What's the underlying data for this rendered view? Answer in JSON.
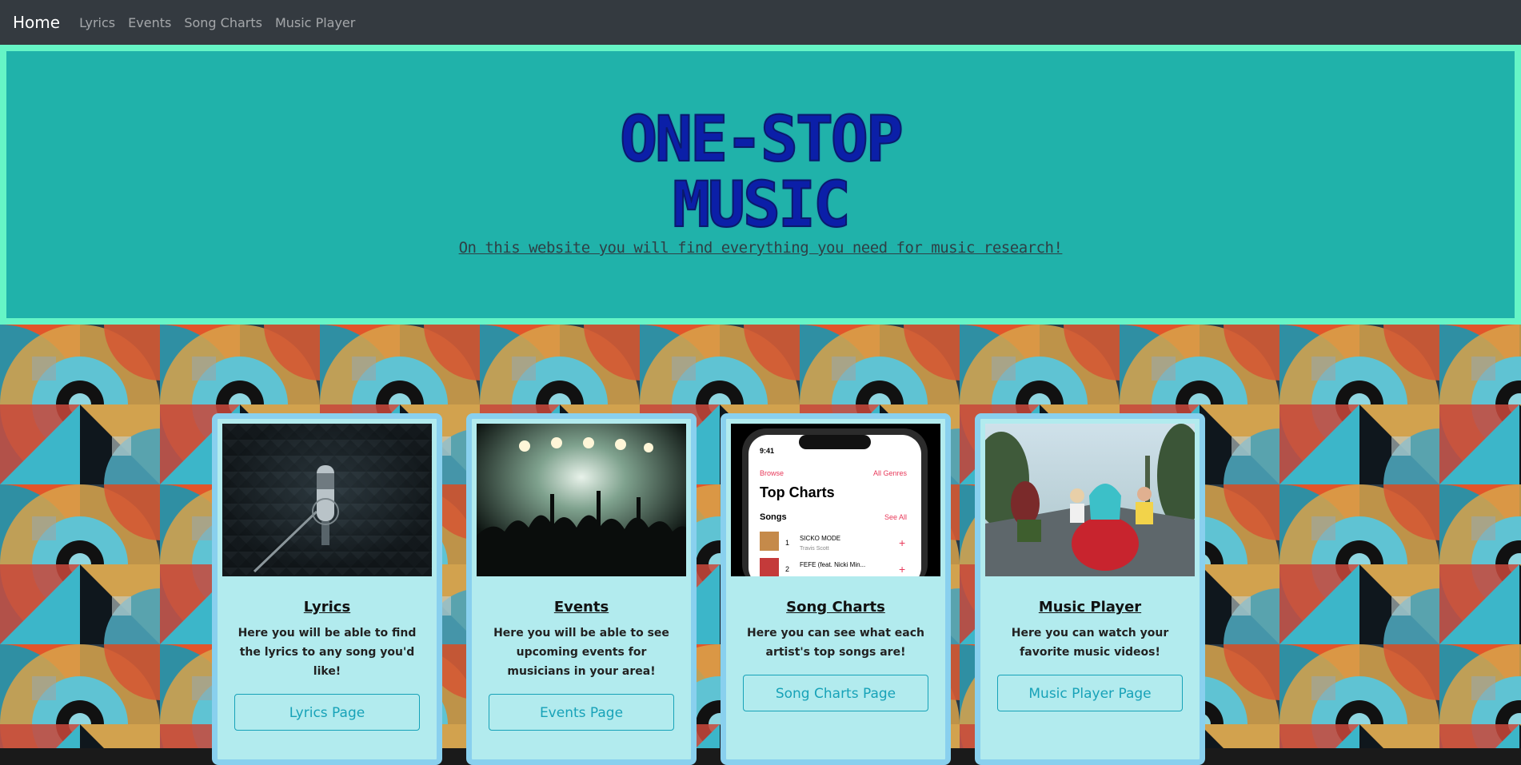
{
  "navbar": {
    "brand": "Home",
    "links": [
      "Lyrics",
      "Events",
      "Song Charts",
      "Music Player"
    ]
  },
  "hero": {
    "title_line1": "ONE-STOP",
    "title_line2": "MUSIC",
    "subtitle": "On this website you will find everything you need for music research!"
  },
  "cards": [
    {
      "title": "Lyrics",
      "text": "Here you will be able to find the lyrics to any song you'd like!",
      "button": "Lyrics Page",
      "image": "microphone-studio-photo"
    },
    {
      "title": "Events",
      "text": "Here you will be able to see upcoming events for musicians in your area!",
      "button": "Events Page",
      "image": "concert-crowd-photo"
    },
    {
      "title": "Song Charts",
      "text": "Here you can see what each artist's top songs are!",
      "button": "Song Charts Page",
      "image": "phone-top-charts-screenshot",
      "phone": {
        "time": "9:41",
        "back": "Browse",
        "genres": "All Genres",
        "heading": "Top Charts",
        "songs_label": "Songs",
        "see_all": "See All",
        "rows": [
          {
            "rank": "1",
            "song": "SICKO MODE",
            "artist": "Travis Scott"
          },
          {
            "rank": "2",
            "song": "FEFE (feat. Nicki Min...",
            "artist": ""
          }
        ]
      }
    },
    {
      "title": "Music Player",
      "text": "Here you can watch your favorite music videos!",
      "button": "Music Player Page",
      "image": "music-video-still-photo"
    }
  ],
  "colors": {
    "navbar_bg": "#343a40",
    "hero_bg": "#20b2aa",
    "hero_border": "#66f5c6",
    "hero_title": "#0b1fa8",
    "card_bg": "#b2ebee",
    "card_border": "#89d0ee",
    "button": "#17a2b8"
  }
}
